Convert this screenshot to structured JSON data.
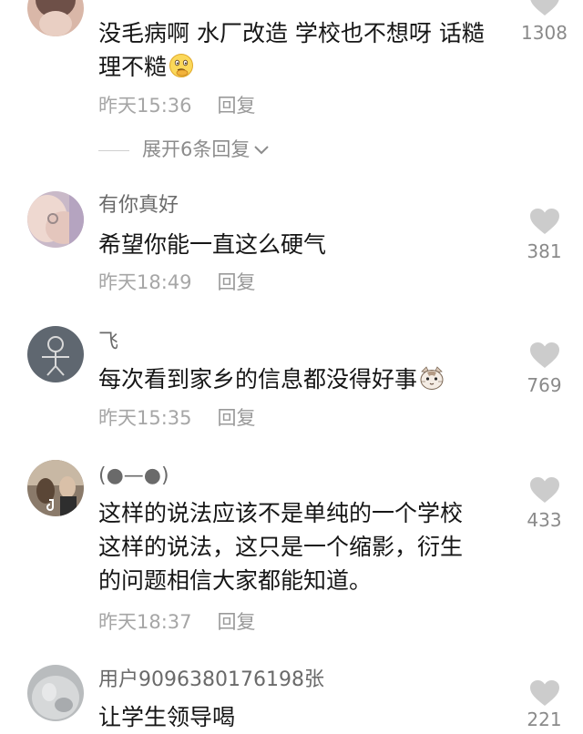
{
  "colors": {
    "text": "#161616",
    "muted": "#a6a6a6",
    "heart": "#cccccc"
  },
  "comments": [
    {
      "username": "",
      "text_lines": [
        "没毛病啊 水厂改造 学校也不想呀 话糙",
        "理不糙"
      ],
      "emoji": "thinking-face-emoji",
      "time": "昨天15:36",
      "reply_label": "回复",
      "likes": "1308"
    },
    {
      "username": "有你真好",
      "text_lines": [
        "希望你能一直这么硬气"
      ],
      "time": "昨天18:49",
      "reply_label": "回复",
      "likes": "381"
    },
    {
      "username": "飞",
      "text_lines": [
        "每次看到家乡的信息都没得好事"
      ],
      "emoji": "cat-face-emoji",
      "time": "昨天15:35",
      "reply_label": "回复",
      "likes": "769"
    },
    {
      "username": "(●—●)",
      "text_lines": [
        "这样的说法应该不是单纯的一个学校",
        "这样的说法，这只是一个缩影，衍生",
        "的问题相信大家都能知道。"
      ],
      "time": "昨天18:37",
      "reply_label": "回复",
      "likes": "433"
    },
    {
      "username": "用户9096380176198张",
      "text_lines": [
        "让学生领导喝"
      ],
      "likes": "221"
    }
  ],
  "expand_replies": {
    "label": "展开6条回复"
  }
}
